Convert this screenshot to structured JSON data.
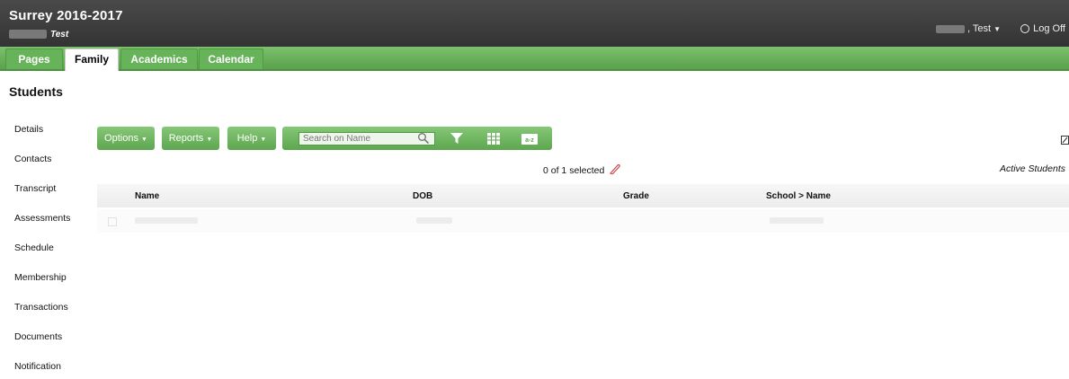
{
  "header": {
    "title": "Surrey 2016-2017",
    "user_sub": "Test",
    "user_menu": ", Test",
    "logoff": "Log Off"
  },
  "tabs": [
    "Pages",
    "Family",
    "Academics",
    "Calendar"
  ],
  "active_tab": "Family",
  "page_title": "Students",
  "sidebar": {
    "items": [
      "Details",
      "Contacts",
      "Transcript",
      "Assessments",
      "Schedule",
      "Membership",
      "Transactions",
      "Documents",
      "Notification"
    ]
  },
  "toolbar": {
    "options_label": "Options",
    "reports_label": "Reports",
    "help_label": "Help",
    "search_placeholder": "Search on Name"
  },
  "selection": {
    "text": "0 of 1 selected",
    "filter": "Active Students"
  },
  "table": {
    "columns": [
      "Name",
      "DOB",
      "Grade",
      "School > Name"
    ]
  },
  "colors": {
    "header_bg": "#3a3a3a",
    "accent_green": "#5fa751",
    "active_tab_bg": "#ffffff"
  }
}
